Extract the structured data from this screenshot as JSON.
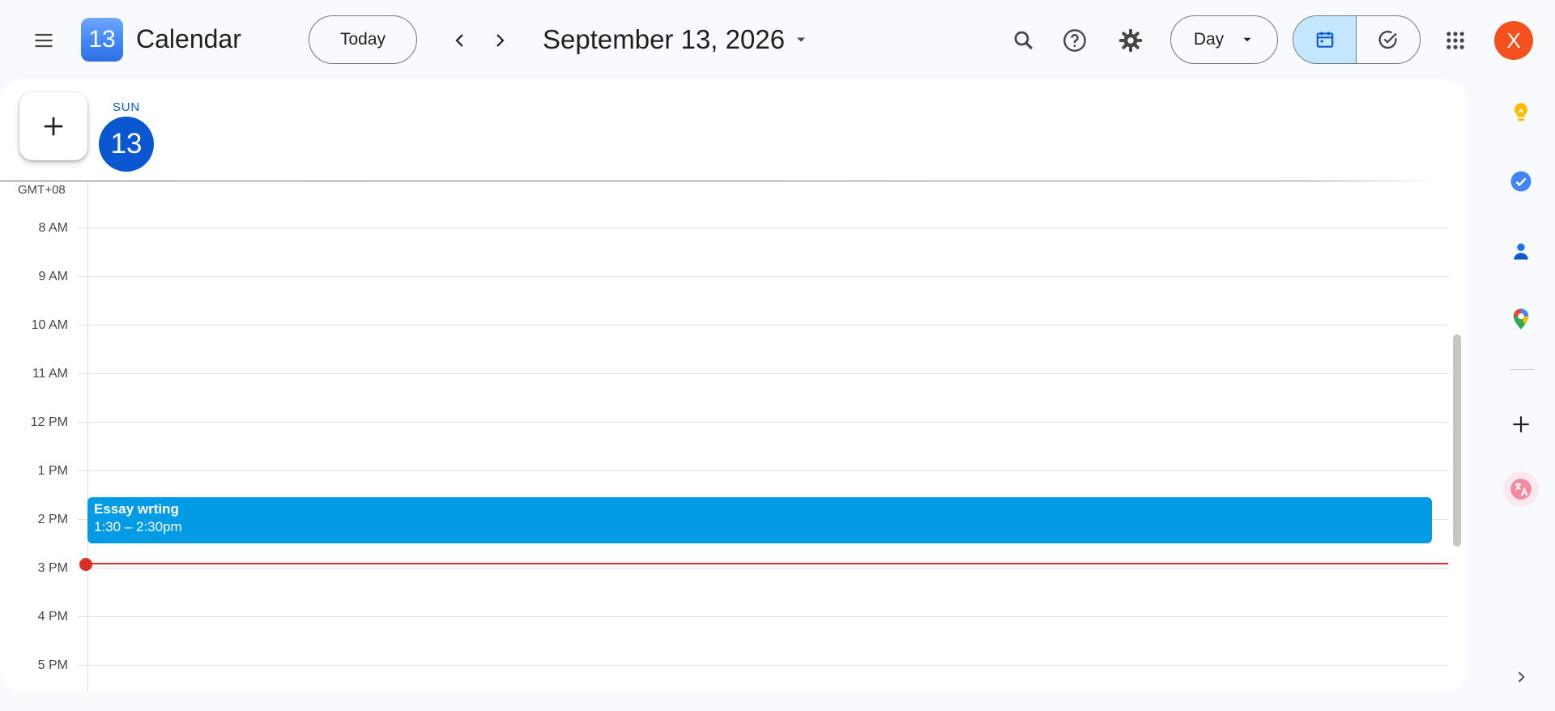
{
  "header": {
    "app_title": "Calendar",
    "logo_day": "13",
    "today_label": "Today",
    "date_title": "September 13, 2026",
    "view_label": "Day",
    "avatar_letter": "X"
  },
  "day": {
    "name": "SUN",
    "number": "13"
  },
  "grid": {
    "timezone": "GMT+08",
    "hours": [
      "8 AM",
      "9 AM",
      "10 AM",
      "11 AM",
      "12 PM",
      "1 PM",
      "2 PM",
      "3 PM",
      "4 PM",
      "5 PM"
    ]
  },
  "event": {
    "title": "Essay wrting",
    "time": "1:30 – 2:30pm",
    "color": "#039be5"
  },
  "colors": {
    "accent": "#0b57d0",
    "now_indicator": "#d93025",
    "avatar": "#f4511e",
    "toggle_active": "#c2e7ff"
  },
  "side_panel": {
    "icons": [
      "keep-icon",
      "tasks-icon",
      "contacts-icon",
      "maps-icon",
      "add-icon",
      "translate-icon",
      "expand-icon"
    ]
  }
}
